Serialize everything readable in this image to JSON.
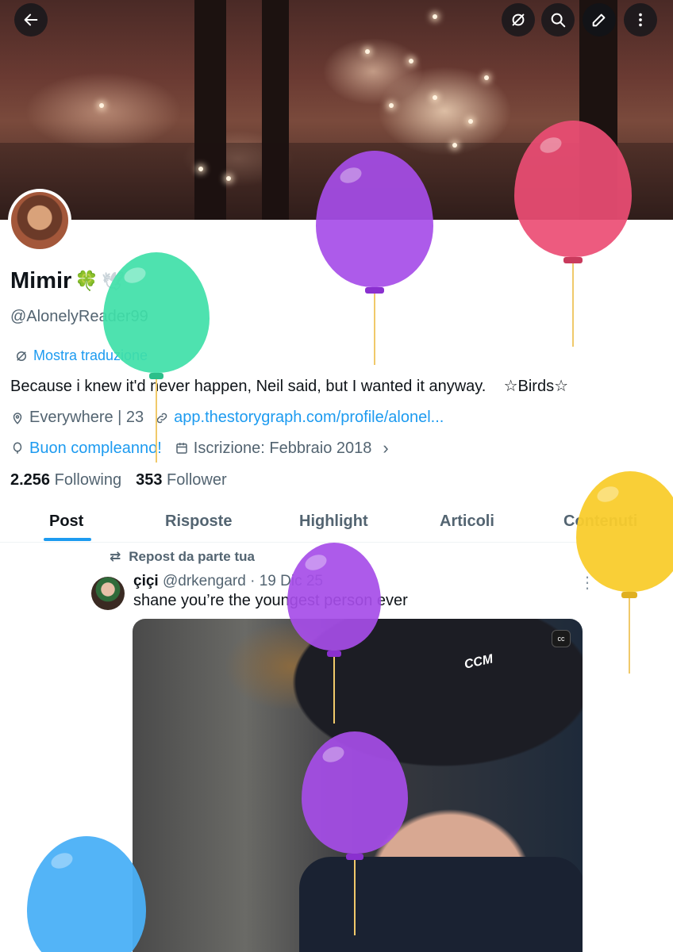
{
  "profile": {
    "name": "Mimir",
    "name_emoji": "🍀",
    "handle": "@AlonelyReader99",
    "translate_label": "Mostra traduzione",
    "bio": "Because i knew it'd never happen, Neil said, but I wanted it anyway.    ☆Birds☆",
    "location": "Everywhere | 23",
    "website": "app.thestorygraph.com/profile/alonel...",
    "birthday": "Buon compleanno!",
    "joined": "Iscrizione: Febbraio 2018",
    "following_count": "2.256",
    "following_label": "Following",
    "followers_count": "353",
    "followers_label": "Follower"
  },
  "tabs": [
    "Post",
    "Risposte",
    "Highlight",
    "Articoli",
    "Contenuti"
  ],
  "active_tab": "Post",
  "post": {
    "repost_label": "Repost da parte tua",
    "author_name": "çiçi",
    "author_handle": "@drkengard",
    "date": "· 19 Dic 25",
    "text": "shane you’re the youngest person ever",
    "media_caption_badge": "cc",
    "helmet_brand": "CCM"
  },
  "icons": [
    "back-arrow-icon",
    "translate-icon",
    "search-icon",
    "edit-icon",
    "more-icon"
  ],
  "colors": {
    "accent": "#1d9bf0",
    "secondary_text": "#536471",
    "balloon_green": "#3fe0a8",
    "balloon_purple": "#a64de8",
    "balloon_pink": "#ec4d74",
    "balloon_yellow": "#f9cc2c",
    "balloon_blue": "#4ab0f7"
  }
}
